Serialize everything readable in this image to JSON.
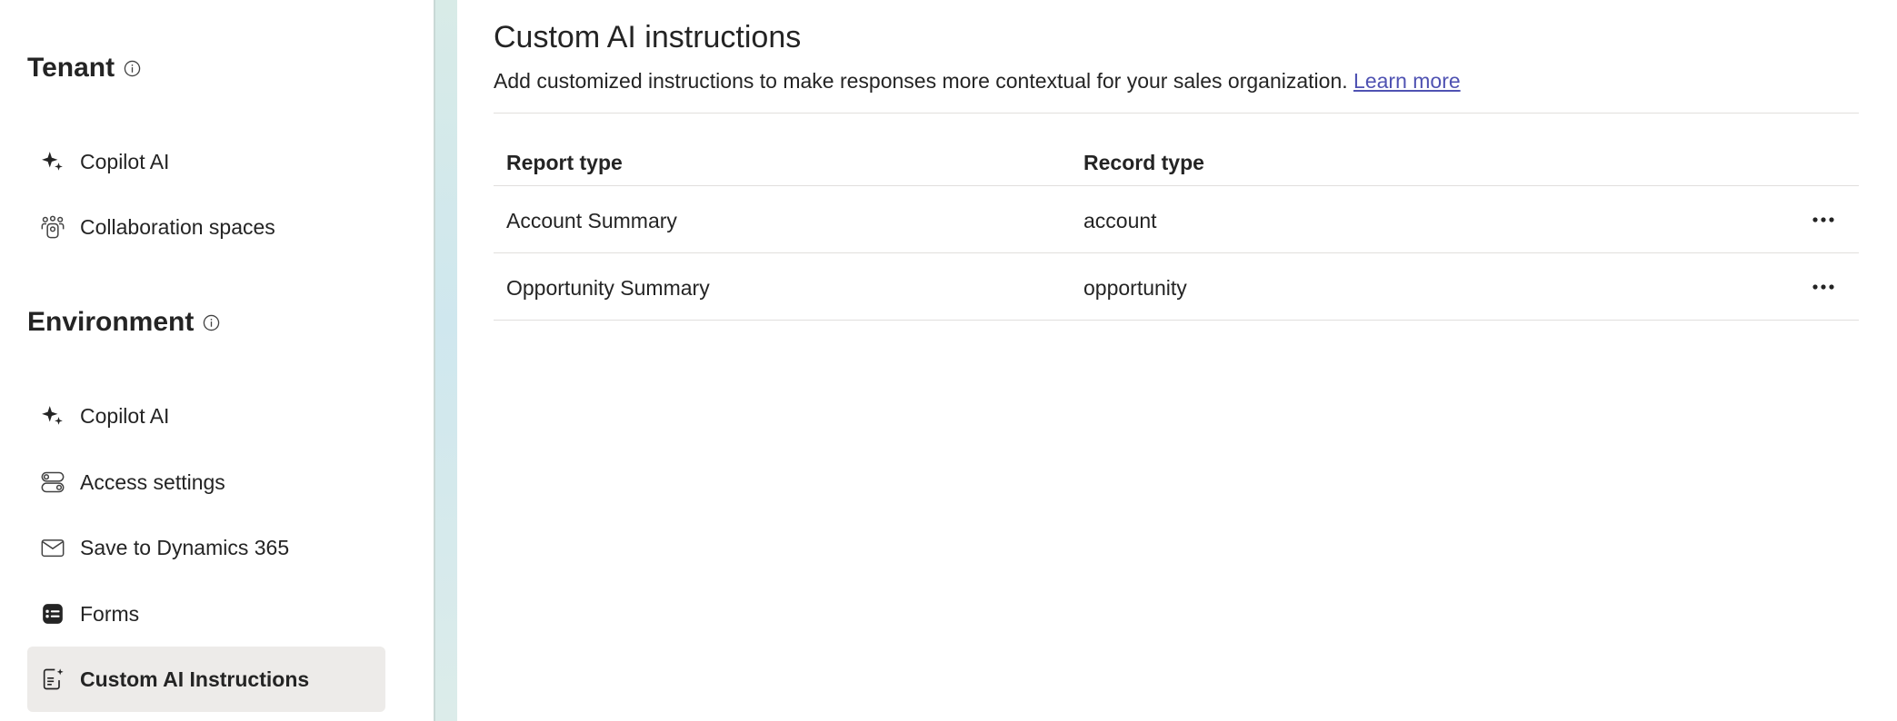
{
  "sidebar": {
    "tenant": {
      "title": "Tenant",
      "items": [
        {
          "label": "Copilot AI",
          "icon": "sparkle-icon"
        },
        {
          "label": "Collaboration spaces",
          "icon": "people-team-icon"
        }
      ]
    },
    "environment": {
      "title": "Environment",
      "items": [
        {
          "label": "Copilot AI",
          "icon": "sparkle-icon"
        },
        {
          "label": "Access settings",
          "icon": "toggle-settings-icon"
        },
        {
          "label": "Save to Dynamics 365",
          "icon": "mail-icon"
        },
        {
          "label": "Forms",
          "icon": "form-icon"
        },
        {
          "label": "Custom AI Instructions",
          "icon": "document-sparkle-icon",
          "active": true
        }
      ]
    }
  },
  "main": {
    "title": "Custom AI instructions",
    "subtitle": "Add customized instructions to make responses more contextual for your sales organization.",
    "learn_more": "Learn more",
    "table": {
      "columns": [
        "Report type",
        "Record type"
      ],
      "rows": [
        {
          "report_type": "Account Summary",
          "record_type": "account"
        },
        {
          "report_type": "Opportunity Summary",
          "record_type": "opportunity"
        }
      ]
    }
  },
  "colors": {
    "active_bg": "#edebe9",
    "link": "#4f52b2",
    "divider_strip": "#cfe7ee"
  }
}
